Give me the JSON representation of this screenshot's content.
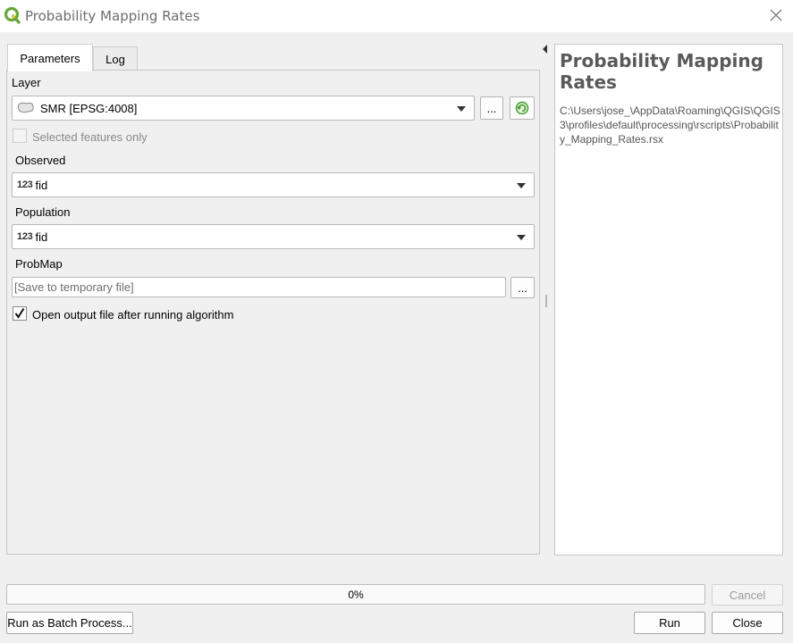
{
  "window": {
    "title": "Probability Mapping Rates",
    "app_icon": "qgis-logo-icon",
    "close_icon": "close-icon"
  },
  "tabs": [
    {
      "label": "Parameters",
      "active": true
    },
    {
      "label": "Log",
      "active": false
    }
  ],
  "params": {
    "layer_label": "Layer",
    "layer_value": "SMR  [EPSG:4008]",
    "layer_browse": "...",
    "selected_only_label": "Selected features only",
    "selected_only_checked": false,
    "observed_label": "Observed",
    "observed_value": "fid",
    "population_label": "Population",
    "population_value": "fid",
    "field_type_glyph": "123",
    "probmap_label": "ProbMap",
    "probmap_placeholder": "[Save to temporary file]",
    "probmap_browse": "...",
    "open_output_label": "Open output file after running algorithm",
    "open_output_checked": true
  },
  "help": {
    "title": "Probability Mapping Rates",
    "path": "C:\\Users\\jose_\\AppData\\Roaming\\QGIS\\QGIS3\\profiles\\default\\processing\\rscripts\\Probability_Mapping_Rates.rsx"
  },
  "progress": {
    "value": 0,
    "label": "0%"
  },
  "buttons": {
    "cancel": "Cancel",
    "batch": "Run as Batch Process...",
    "run": "Run",
    "close": "Close"
  },
  "colors": {
    "qgis_green": "#6aa739",
    "qgis_yellow": "#f0c419",
    "title_grey": "#6d6d6d"
  }
}
